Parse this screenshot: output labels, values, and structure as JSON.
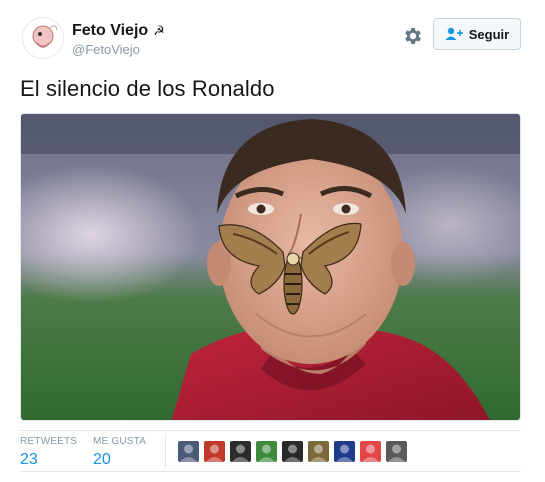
{
  "user": {
    "name": "Feto Viejo",
    "name_emoji": "☭",
    "handle": "@FetoViejo"
  },
  "follow_button": {
    "label": "Seguir",
    "icon": "add-user-icon"
  },
  "settings": {
    "icon": "gear-icon"
  },
  "tweet": {
    "text": "El silencio de los Ronaldo"
  },
  "stats": {
    "retweets_label": "RETWEETS",
    "retweets_value": "23",
    "likes_label": "ME GUSTA",
    "likes_value": "20"
  },
  "likers": [
    {
      "color": "#4a5a78"
    },
    {
      "color": "#c0392b"
    },
    {
      "color": "#2c2c2c"
    },
    {
      "color": "#3d8a3d"
    },
    {
      "color": "#2a2a2a"
    },
    {
      "color": "#7a6a3a"
    },
    {
      "color": "#1f3c8c"
    },
    {
      "color": "#e04848"
    },
    {
      "color": "#5a5a5a"
    }
  ],
  "colors": {
    "accent": "#1b95e0",
    "muted": "#8899a6",
    "border": "#e1e8ed"
  }
}
